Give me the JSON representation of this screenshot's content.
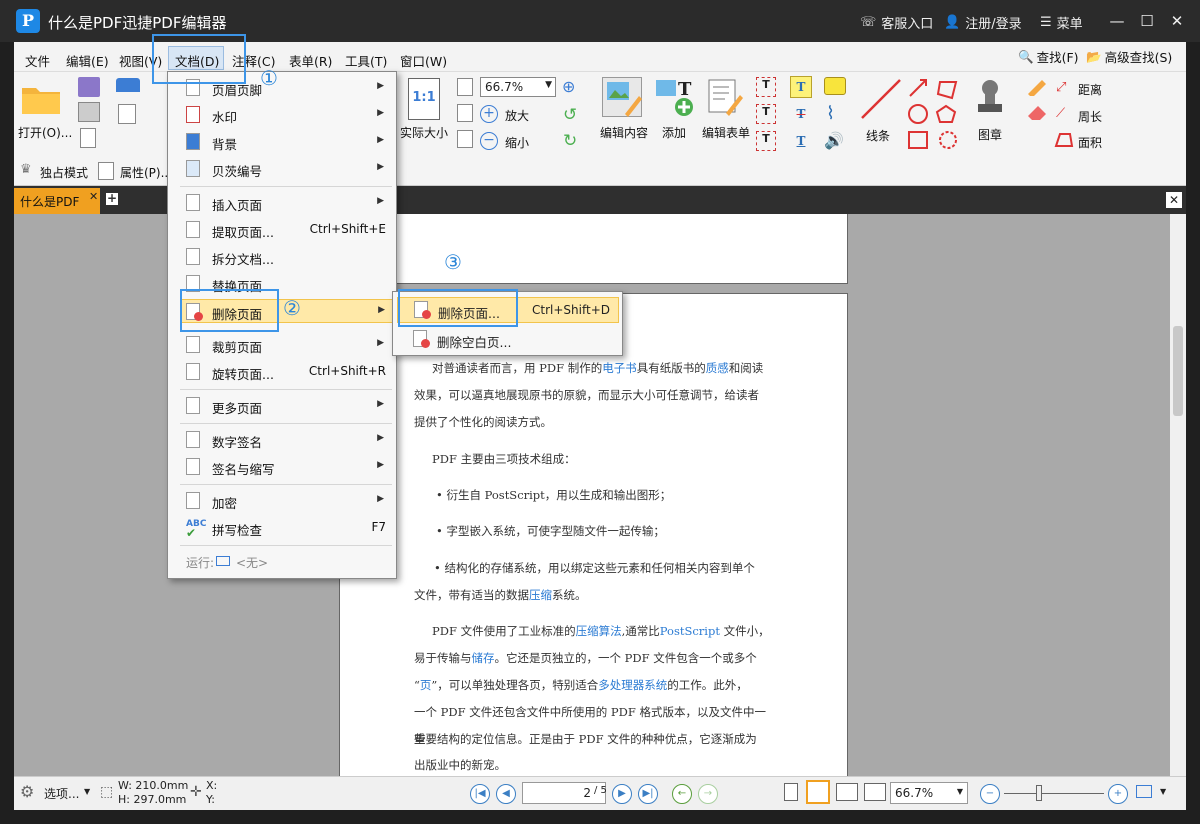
{
  "app": {
    "title": "什么是PDF迅捷PDF编辑器"
  },
  "titlebar": {
    "service": "客服入口",
    "login": "注册/登录",
    "menu": "菜单"
  },
  "menubar": {
    "items": [
      "文件",
      "编辑(E)",
      "视图(V)",
      "文档(D)",
      "注释(C)",
      "表单(R)",
      "工具(T)",
      "窗口(W)"
    ],
    "find": "查找(F)",
    "advanced_find": "高级查找(S)"
  },
  "toolbar": {
    "open": "打开(O)...",
    "actual_size": "实际大小",
    "zoom_value": "66.7%",
    "zoom_in": "放大",
    "zoom_out": "缩小",
    "edit_content": "编辑内容",
    "add": "添加",
    "edit_form": "编辑表单",
    "line": "线条",
    "stamp": "图章",
    "distance": "距离",
    "perimeter": "周长",
    "area": "面积"
  },
  "toolbar2": {
    "exclusive_mode": "独占模式",
    "properties": "属性(P)..."
  },
  "tabs": {
    "doc_tab": "什么是PDF"
  },
  "document_menu": {
    "items": [
      {
        "label": "页眉页脚",
        "has_sub": true
      },
      {
        "label": "水印",
        "has_sub": true
      },
      {
        "label": "背景",
        "has_sub": true
      },
      {
        "label": "贝茨编号",
        "has_sub": true
      },
      {
        "label": "插入页面",
        "has_sub": true
      },
      {
        "label": "提取页面...",
        "shortcut": "Ctrl+Shift+E"
      },
      {
        "label": "拆分文档..."
      },
      {
        "label": "替换页面..."
      },
      {
        "label": "删除页面",
        "has_sub": true
      },
      {
        "label": "裁剪页面",
        "has_sub": true
      },
      {
        "label": "旋转页面...",
        "shortcut": "Ctrl+Shift+R"
      },
      {
        "label": "更多页面",
        "has_sub": true
      },
      {
        "label": "数字签名",
        "has_sub": true
      },
      {
        "label": "签名与缩写",
        "has_sub": true
      },
      {
        "label": "加密",
        "has_sub": true
      },
      {
        "label": "拼写检查",
        "shortcut": "F7"
      }
    ],
    "run_label": "运行:",
    "run_value": "<无>"
  },
  "delete_submenu": {
    "delete_pages": "删除页面...",
    "delete_shortcut": "Ctrl+Shift+D",
    "delete_blank": "删除空白页..."
  },
  "callouts": {
    "one": "①",
    "two": "②",
    "three": "③"
  },
  "document": {
    "p1_a": "对普通读者而言，用 PDF 制作的",
    "p1_link1": "电子书",
    "p1_b": "具有纸版书的",
    "p1_link2": "质感",
    "p1_c": "和阅读",
    "p1_line2": "效果，可以逼真地展现原书的原貌，而显示大小可任意调节，给读者",
    "p1_line3": "提供了个性化的阅读方式。",
    "p2": "PDF 主要由三项技术组成：",
    "b1": "•  衍生自 PostScript，用以生成和输出图形；",
    "b2": "•  字型嵌入系统，可使字型随文件一起传输；",
    "b3_line1": "• 结构化的存储系统，用以绑定这些元素和任何相关内容到单个",
    "b3_line2_a": "文件，带有适当的数据",
    "b3_link": "压缩",
    "b3_line2_b": "系统。",
    "p3_a": "PDF 文件使用了工业标准的",
    "p3_link1": "压缩算法",
    "p3_b": ",通常比",
    "p3_link2": "PostScript",
    "p3_c": " 文件小，",
    "p3_l2_a": "易于传输与",
    "p3_l2_link": "储存",
    "p3_l2_b": "。它还是页独立的，一个 PDF 文件包含一个或多个",
    "p3_l3_a": "“",
    "p3_l3_link": "页",
    "p3_l3_b": "”，可以单独处理各页，特别适合",
    "p3_l3_link2": "多处理器系统",
    "p3_l3_c": "的工作。此外，",
    "p3_l4": "一个 PDF 文件还包含文件中所使用的 PDF 格式版本，以及文件中一些",
    "p3_l5": "重要结构的定位信息。正是由于 PDF 文件的种种优点，它逐渐成为",
    "p3_l6": "出版业中的新宠。"
  },
  "statusbar": {
    "options": "选项...",
    "width": "W: 210.0mm",
    "height": "H: 297.0mm",
    "x": "X:",
    "y": "Y:",
    "page_current": "2",
    "page_total": "/ 5",
    "zoom_value": "66.7%"
  },
  "colors": {
    "accent": "#3d95e8",
    "tab_active": "#f0a020",
    "highlight": "#ffe9a8",
    "link": "#2b7bd3"
  }
}
